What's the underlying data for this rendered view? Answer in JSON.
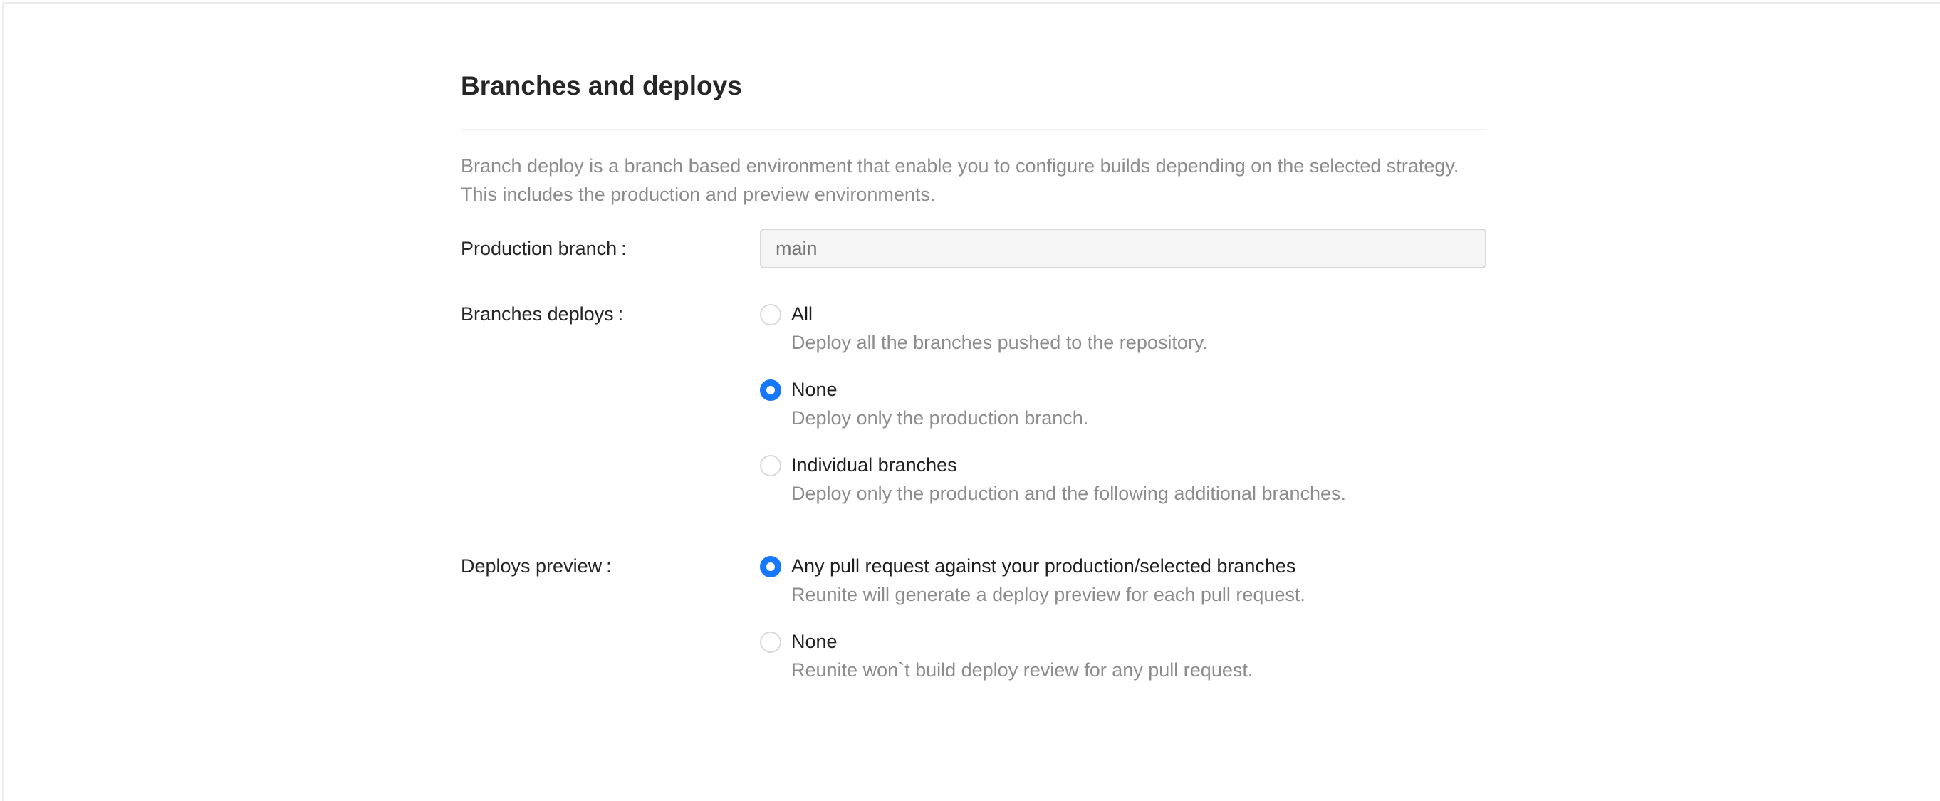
{
  "page": {
    "title": "Branches and deploys",
    "description": "Branch deploy is a branch based environment that enable you to configure builds depending on the selected strategy. This includes the production and preview environments."
  },
  "production_branch": {
    "label": "Production branch",
    "colon": ":",
    "placeholder": "main",
    "value": ""
  },
  "branches_deploys": {
    "label": "Branches deploys",
    "colon": ":",
    "selected": "None",
    "options": [
      {
        "title": "All",
        "description": "Deploy all the branches pushed to the repository.",
        "checked": false
      },
      {
        "title": "None",
        "description": "Deploy only the production branch.",
        "checked": true
      },
      {
        "title": "Individual branches",
        "description": "Deploy only the production and the following additional branches.",
        "checked": false
      }
    ]
  },
  "deploys_preview": {
    "label": "Deploys preview",
    "colon": ":",
    "selected": "Any pull request against your production/selected branches",
    "options": [
      {
        "title": "Any pull request against your production/selected branches",
        "description": "Reunite will generate a deploy preview for each pull request.",
        "checked": true
      },
      {
        "title": "None",
        "description": "Reunite won`t build deploy review for any pull request.",
        "checked": false
      }
    ]
  },
  "colors": {
    "accent": "#1677ff",
    "text": "#262626",
    "muted": "#8c8c8c",
    "border": "#d9d9d9"
  }
}
